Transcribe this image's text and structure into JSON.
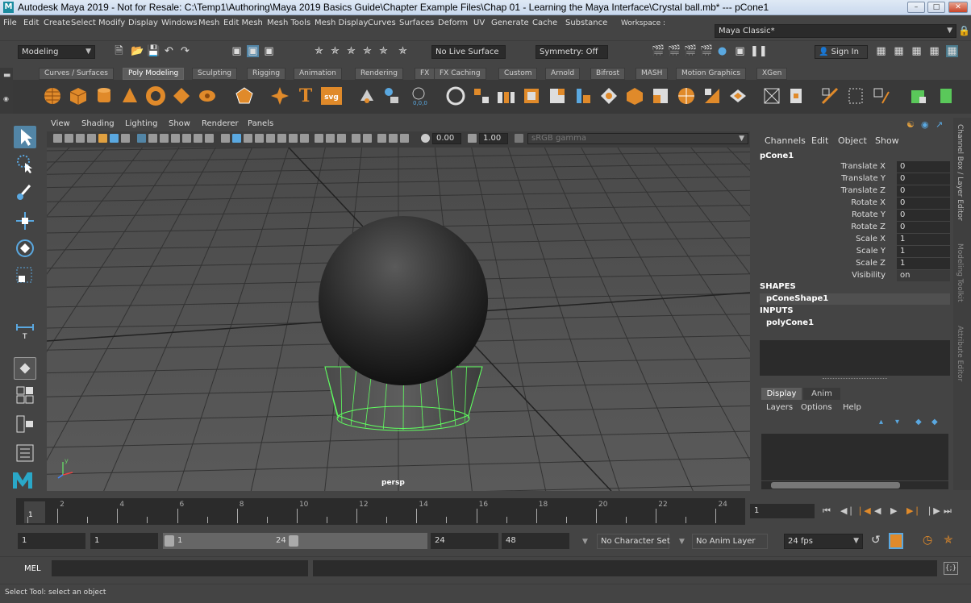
{
  "window": {
    "title": "Autodesk Maya 2019 - Not for Resale: C:\\Temp1\\Authoring\\Maya 2019 Basics Guide\\Chapter Example Files\\Chap 01 - Learning the Maya Interface\\Crystal ball.mb*  ---  pCone1",
    "logo": "M"
  },
  "menubar": {
    "items": [
      "File",
      "Edit",
      "Create",
      "Select",
      "Modify",
      "Display",
      "Windows",
      "Mesh",
      "Edit Mesh",
      "Mesh Tools",
      "Mesh Display",
      "Curves",
      "Surfaces",
      "Deform",
      "UV",
      "Generate",
      "Cache",
      "Substance"
    ],
    "workspace_label": "Workspace :",
    "workspace_value": "Maya Classic*"
  },
  "toolbar": {
    "menuset": "Modeling",
    "live_surface": "No Live Surface",
    "symmetry": "Symmetry: Off",
    "sign_in": "Sign In"
  },
  "shelf": {
    "tabs": [
      "Curves / Surfaces",
      "Poly Modeling",
      "Sculpting",
      "Rigging",
      "Animation",
      "Rendering",
      "FX",
      "FX Caching",
      "Custom",
      "Arnold",
      "Bifrost",
      "MASH",
      "Motion Graphics",
      "XGen"
    ],
    "active_tab": "Poly Modeling",
    "text_icon": "T",
    "svg_icon": "svg"
  },
  "panel": {
    "menus": [
      "View",
      "Shading",
      "Lighting",
      "Show",
      "Renderer",
      "Panels"
    ],
    "field1": "0.00",
    "field2": "1.00",
    "color_space": "sRGB gamma",
    "camera_label": "persp",
    "axis_y": "y"
  },
  "channel_box": {
    "menus": [
      "Channels",
      "Edit",
      "Object",
      "Show"
    ],
    "object": "pCone1",
    "attributes": [
      {
        "label": "Translate X",
        "value": "0"
      },
      {
        "label": "Translate Y",
        "value": "0"
      },
      {
        "label": "Translate Z",
        "value": "0"
      },
      {
        "label": "Rotate X",
        "value": "0"
      },
      {
        "label": "Rotate Y",
        "value": "0"
      },
      {
        "label": "Rotate Z",
        "value": "0"
      },
      {
        "label": "Scale X",
        "value": "1"
      },
      {
        "label": "Scale Y",
        "value": "1"
      },
      {
        "label": "Scale Z",
        "value": "1"
      },
      {
        "label": "Visibility",
        "value": "on"
      }
    ],
    "shapes_header": "SHAPES",
    "shape_name": "pConeShape1",
    "inputs_header": "INPUTS",
    "input_name": "polyCone1"
  },
  "side_tabs": [
    "Channel Box / Layer Editor",
    "Modeling Toolkit",
    "Attribute Editor"
  ],
  "layer_editor": {
    "tabs": [
      "Display",
      "Anim"
    ],
    "menus": [
      "Layers",
      "Options",
      "Help"
    ]
  },
  "timeline": {
    "ticks": [
      "2",
      "4",
      "6",
      "8",
      "10",
      "12",
      "14",
      "16",
      "18",
      "20",
      "22",
      "24"
    ],
    "current_frame_label": "1",
    "current_frame_field": "1"
  },
  "range": {
    "start": "1",
    "playback_start": "1",
    "slider_start": "1",
    "slider_end": "24",
    "playback_end": "24",
    "end": "48",
    "character_set": "No Character Set",
    "anim_layer": "No Anim Layer",
    "fps": "24 fps"
  },
  "command_line": {
    "lang": "MEL"
  },
  "help_line": {
    "text": "Select Tool: select an object"
  }
}
